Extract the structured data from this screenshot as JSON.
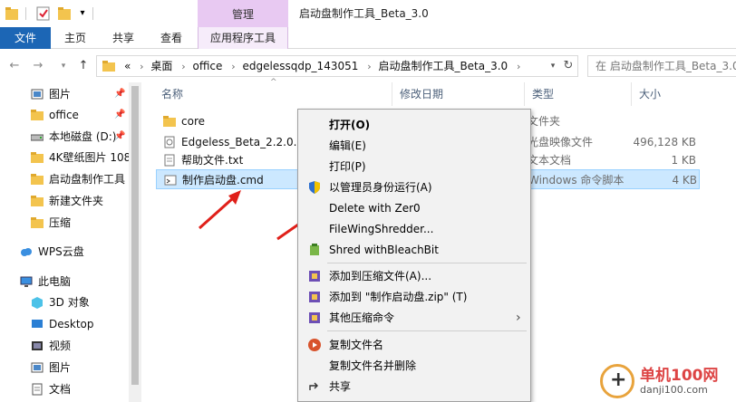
{
  "title_bar": {
    "manage_tab": "管理",
    "window_title": "启动盘制作工具_Beta_3.0"
  },
  "ribbon": {
    "tabs": [
      "文件",
      "主页",
      "共享",
      "查看",
      "应用程序工具"
    ]
  },
  "address": {
    "crumbs": [
      "桌面",
      "office",
      "edgelessqdp_143051",
      "启动盘制作工具_Beta_3.0"
    ],
    "lead": "«",
    "search_placeholder": "在 启动盘制作工具_Beta_3.0"
  },
  "nav_pane": {
    "items": [
      {
        "label": "图片",
        "icon": "pictures-icon",
        "pinned": true
      },
      {
        "label": "office",
        "icon": "folder-icon",
        "pinned": true
      },
      {
        "label": "本地磁盘 (D:)",
        "icon": "drive-icon",
        "pinned": true
      },
      {
        "label": "4K壁纸图片 108",
        "icon": "folder-icon",
        "pinned": false
      },
      {
        "label": "启动盘制作工具",
        "icon": "folder-icon",
        "pinned": false
      },
      {
        "label": "新建文件夹",
        "icon": "folder-icon",
        "pinned": false
      },
      {
        "label": "压缩",
        "icon": "folder-icon",
        "pinned": false
      },
      {
        "label": "WPS云盘",
        "icon": "cloud-icon",
        "pinned": false
      },
      {
        "label": "此电脑",
        "icon": "computer-icon",
        "pinned": false
      },
      {
        "label": "3D 对象",
        "icon": "3d-objects-icon",
        "pinned": false
      },
      {
        "label": "Desktop",
        "icon": "desktop-icon",
        "pinned": false
      },
      {
        "label": "视频",
        "icon": "video-icon",
        "pinned": false
      },
      {
        "label": "图片",
        "icon": "pictures-icon",
        "pinned": false
      },
      {
        "label": "文档",
        "icon": "documents-icon",
        "pinned": false
      }
    ]
  },
  "columns": {
    "name": "名称",
    "date": "修改日期",
    "type": "类型",
    "size": "大小"
  },
  "files": [
    {
      "name": "core",
      "type": "文件夹",
      "size": "",
      "icon": "folder-icon",
      "selected": false
    },
    {
      "name": "Edgeless_Beta_2.2.0.is",
      "type": "光盘映像文件",
      "size": "496,128 KB",
      "icon": "disc-image-icon",
      "selected": false
    },
    {
      "name": "帮助文件.txt",
      "type": "文本文档",
      "size": "1 KB",
      "icon": "text-file-icon",
      "selected": false
    },
    {
      "name": "制作启动盘.cmd",
      "type": "Windows 命令脚本",
      "size": "4 KB",
      "icon": "cmd-file-icon",
      "selected": true
    }
  ],
  "context_menu": {
    "items": [
      {
        "label": "打开(O)",
        "bold": true,
        "icon": ""
      },
      {
        "label": "编辑(E)",
        "bold": false,
        "icon": ""
      },
      {
        "label": "打印(P)",
        "bold": false,
        "icon": ""
      },
      {
        "label": "以管理员身份运行(A)",
        "bold": false,
        "icon": "uac-shield-icon"
      },
      {
        "label": "Delete with Zer0",
        "bold": false,
        "icon": ""
      },
      {
        "label": "FileWingShredder...",
        "bold": false,
        "icon": ""
      },
      {
        "label": "Shred withBleachBit",
        "bold": false,
        "icon": "bleachbit-icon"
      },
      {
        "label": "添加到压缩文件(A)...",
        "bold": false,
        "icon": "archive-icon"
      },
      {
        "label": "添加到 \"制作启动盘.zip\" (T)",
        "bold": false,
        "icon": "archive-icon"
      },
      {
        "label": "其他压缩命令",
        "bold": false,
        "icon": "archive-icon",
        "submenu": true
      },
      {
        "label": "复制文件名",
        "bold": false,
        "icon": "copy-name-icon"
      },
      {
        "label": "复制文件名并删除",
        "bold": false,
        "icon": ""
      },
      {
        "label": "共享",
        "bold": false,
        "icon": "share-icon"
      }
    ]
  },
  "watermark": {
    "title": "单机100网",
    "site": "danji100.com"
  },
  "colors": {
    "file_tab": "#1c66b5",
    "manage_tab": "#e8c9f2",
    "selection": "#cce8ff",
    "arrow": "#e0201a"
  }
}
